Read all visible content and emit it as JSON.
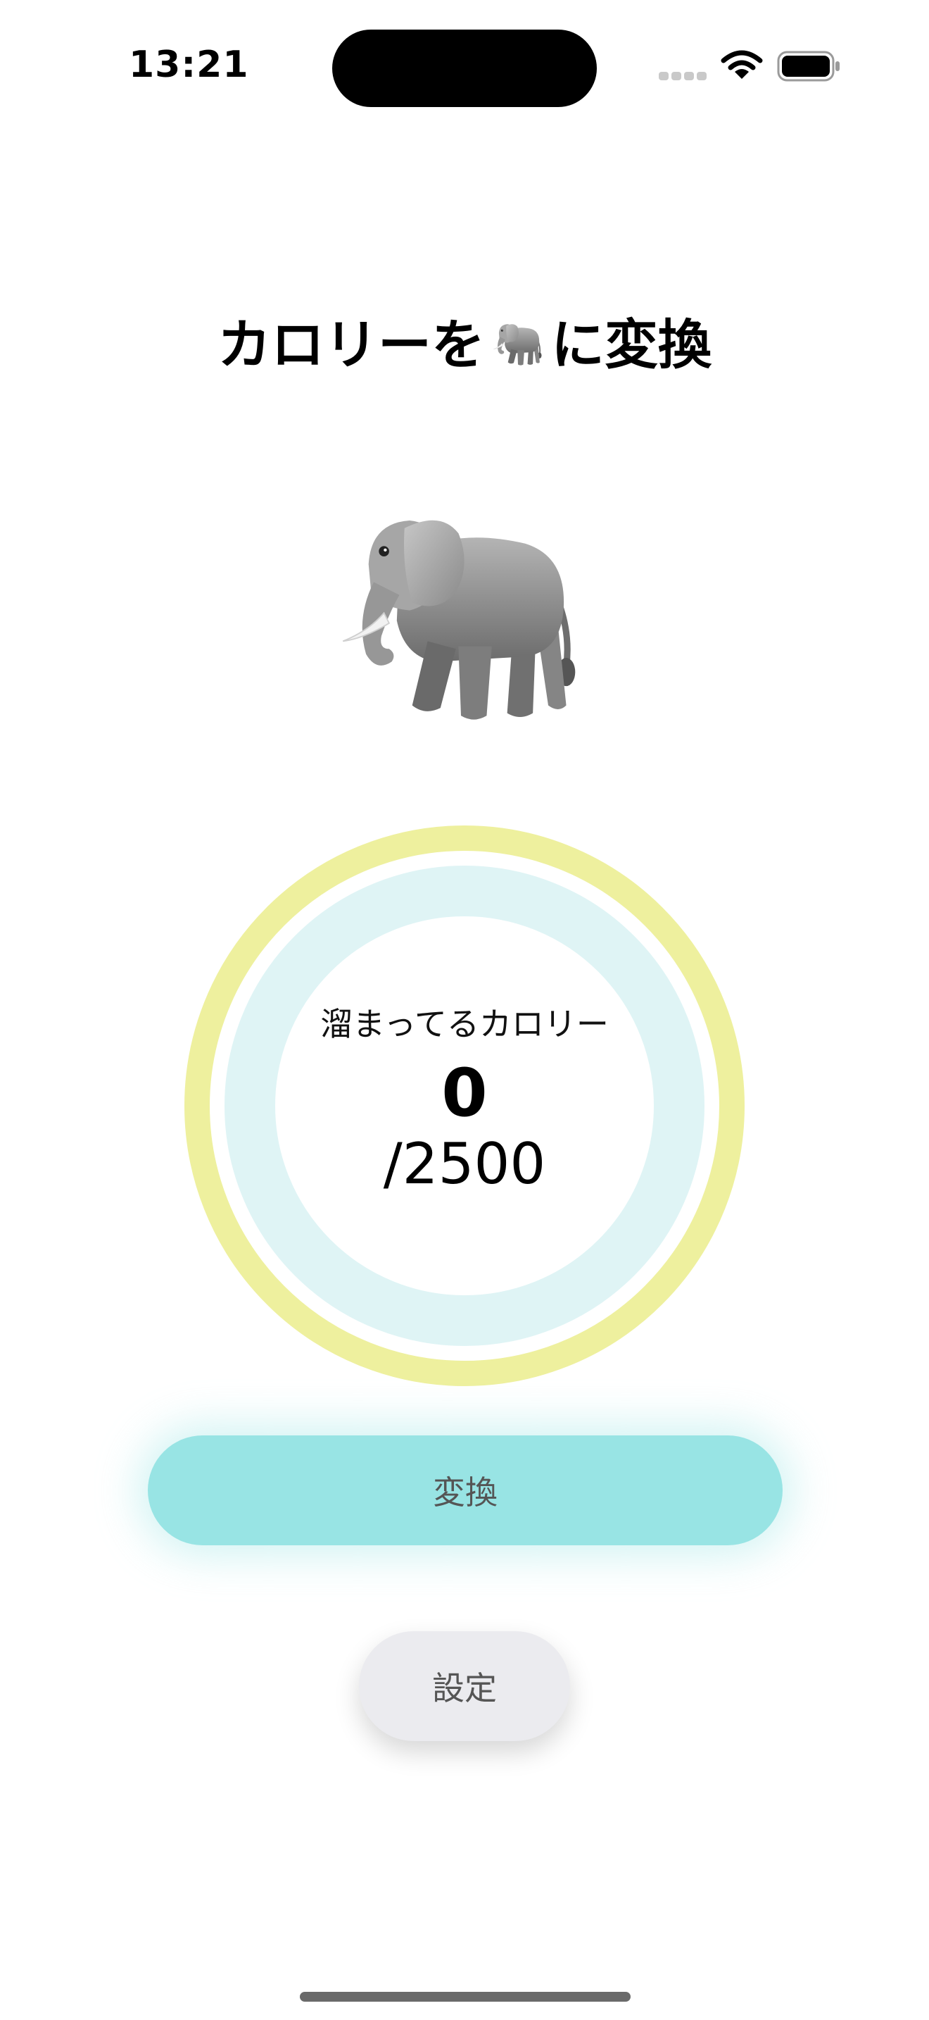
{
  "status_bar": {
    "time": "13:21"
  },
  "header": {
    "title_before": "カロリーを",
    "title_emoji": "elephant-icon",
    "title_after": "に変換"
  },
  "hero": {
    "icon": "elephant-icon"
  },
  "calorie_ring": {
    "label": "溜まってるカロリー",
    "value": "0",
    "goal": "/2500",
    "progress": 0,
    "colors": {
      "outer_ring": "#eef09e",
      "inner_ring": "#dff4f5"
    }
  },
  "actions": {
    "convert_label": "変換",
    "settings_label": "設定"
  },
  "colors": {
    "accent": "#98e4e4",
    "secondary_button": "#ebebef"
  }
}
